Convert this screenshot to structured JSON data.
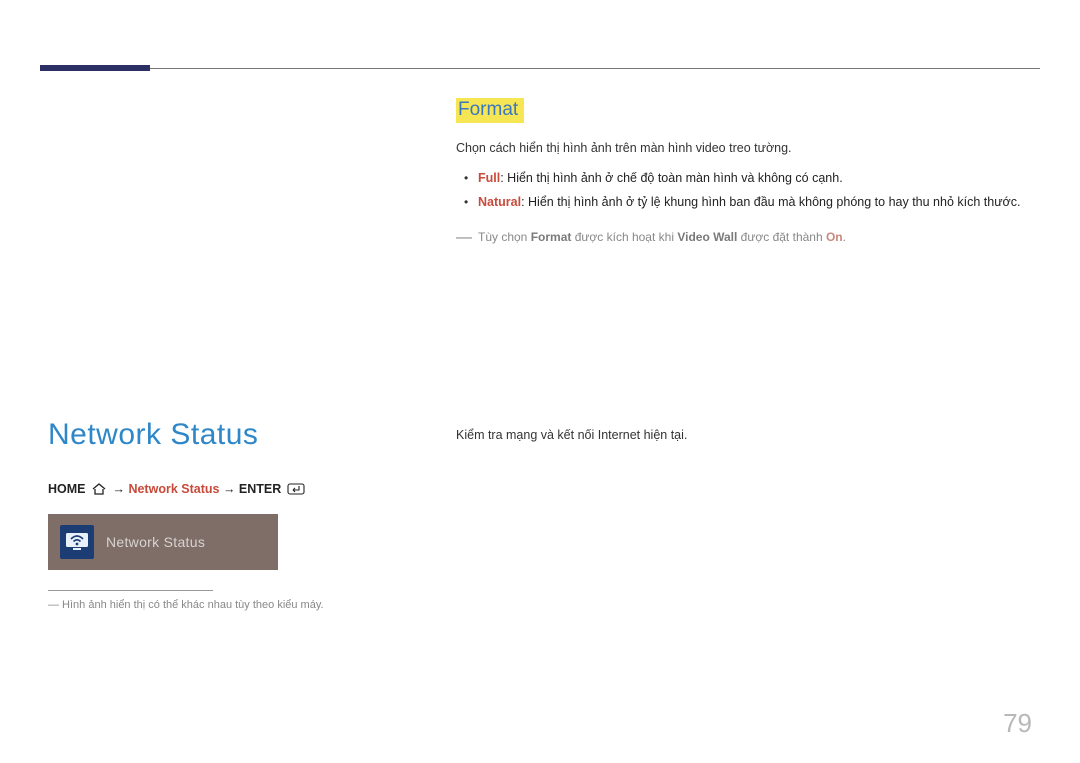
{
  "format_section": {
    "title": "Format",
    "intro": "Chọn cách hiển thị hình ảnh trên màn hình video treo tường.",
    "items": [
      {
        "label": "Full",
        "desc": ": Hiển thị hình ảnh ở chế độ toàn màn hình và không có cạnh."
      },
      {
        "label": "Natural",
        "desc": ": Hiển thị hình ảnh ở tỷ lệ khung hình ban đầu mà không phóng to hay thu nhỏ kích thước."
      }
    ],
    "note": {
      "prefix": "Tùy chọn ",
      "k1": "Format",
      "mid": " được kích hoạt khi ",
      "k2": "Video Wall",
      "mid2": " được đặt thành ",
      "k3": "On",
      "suffix": "."
    }
  },
  "network_section": {
    "title": "Network Status",
    "breadcrumb": {
      "home": "HOME",
      "arrow": " → ",
      "item": "Network Status",
      "enter": "ENTER"
    },
    "tile_label": "Network Status",
    "footnote": "― Hình ảnh hiển thị có thể khác nhau tùy theo kiểu máy.",
    "right_text": "Kiểm tra mạng và kết nối Internet hiện tại."
  },
  "page_number": "79"
}
